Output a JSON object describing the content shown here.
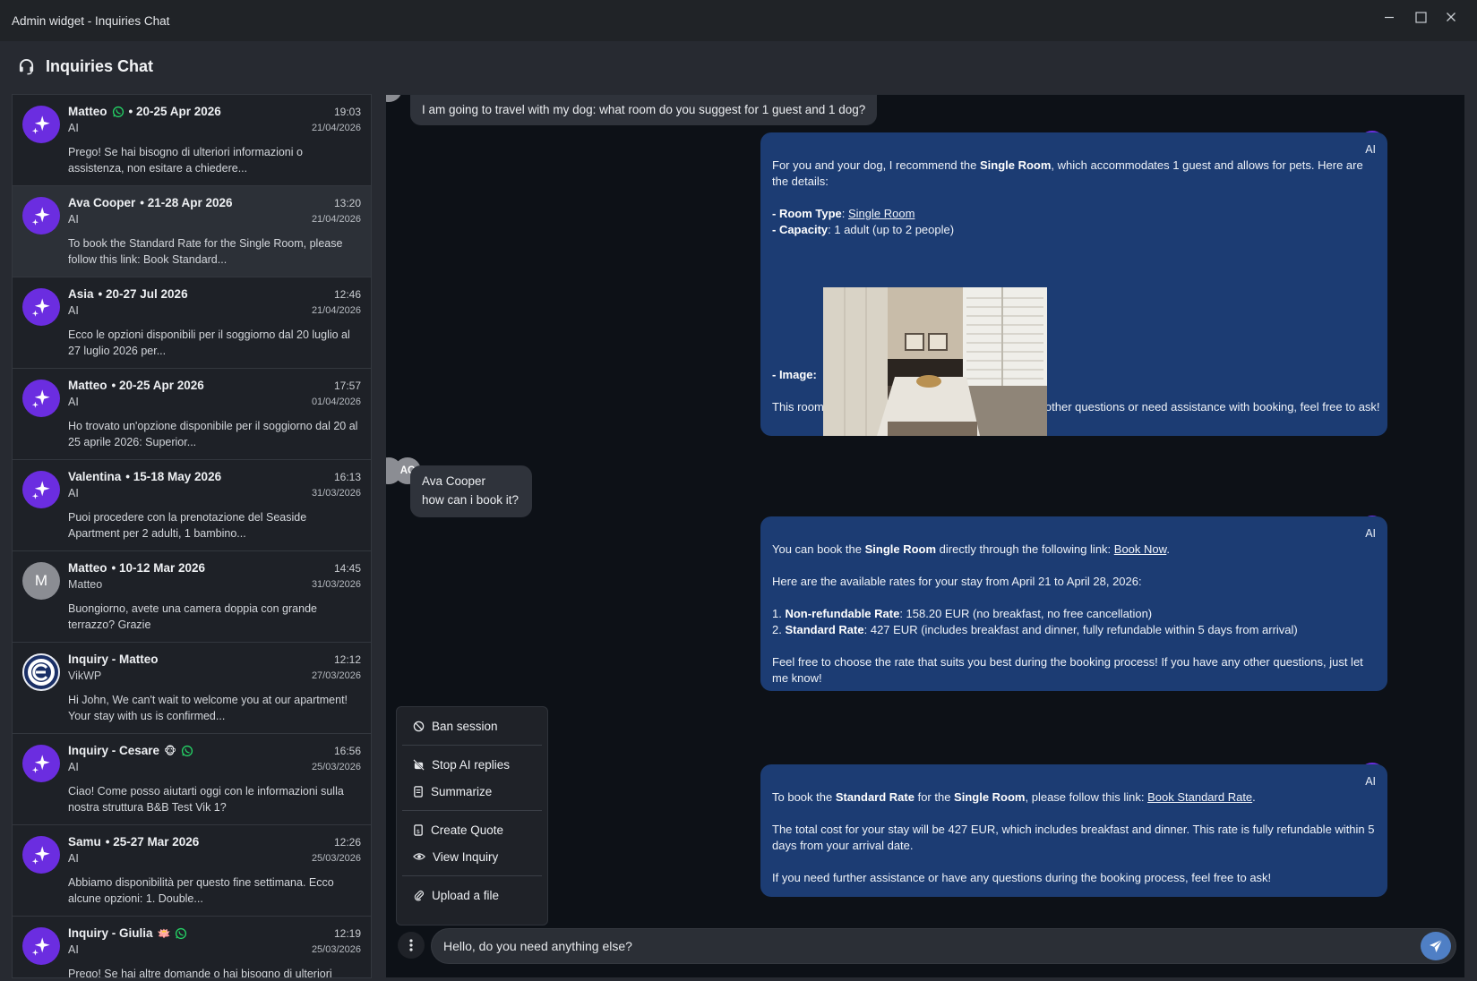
{
  "window": {
    "title": "Admin widget - Inquiries Chat"
  },
  "header": {
    "title": "Inquiries Chat"
  },
  "inquiries": [
    {
      "name": "Matteo",
      "whatsapp": true,
      "emoji": "",
      "dates": "• 20-25 Apr 2026",
      "time": "19:03",
      "sub": "AI",
      "date": "21/04/2026",
      "preview": "Prego! Se hai bisogno di ulteriori informazioni o assistenza, non esitare a chiedere...",
      "avatar": "ai"
    },
    {
      "name": "Ava Cooper",
      "whatsapp": false,
      "emoji": "",
      "dates": "• 21-28 Apr 2026",
      "time": "13:20",
      "sub": "AI",
      "date": "21/04/2026",
      "preview": "To book the Standard Rate for the Single Room, please follow this link: Book Standard...",
      "avatar": "ai"
    },
    {
      "name": "Asia",
      "whatsapp": false,
      "emoji": "",
      "dates": "• 20-27 Jul 2026",
      "time": "12:46",
      "sub": "AI",
      "date": "21/04/2026",
      "preview": "Ecco le opzioni disponibili per il soggiorno dal 20 luglio al 27 luglio 2026 per...",
      "avatar": "ai"
    },
    {
      "name": "Matteo",
      "whatsapp": false,
      "emoji": "",
      "dates": "• 20-25 Apr 2026",
      "time": "17:57",
      "sub": "AI",
      "date": "01/04/2026",
      "preview": "Ho trovato un'opzione disponibile per il soggiorno dal 20 al 25 aprile 2026: Superior...",
      "avatar": "ai"
    },
    {
      "name": "Valentina",
      "whatsapp": false,
      "emoji": "",
      "dates": "• 15-18 May 2026",
      "time": "16:13",
      "sub": "AI",
      "date": "31/03/2026",
      "preview": "Puoi procedere con la prenotazione del Seaside Apartment per 2 adulti, 1 bambino...",
      "avatar": "ai"
    },
    {
      "name": "Matteo",
      "whatsapp": false,
      "emoji": "",
      "dates": "• 10-12 Mar 2026",
      "time": "14:45",
      "sub": "Matteo",
      "date": "31/03/2026",
      "preview": "Buongiorno, avete una camera doppia con grande terrazzo? Grazie",
      "avatar": "m",
      "avatar_letter": "M"
    },
    {
      "name": "Inquiry - Matteo",
      "whatsapp": false,
      "emoji": "",
      "dates": "",
      "time": "12:12",
      "sub": "VikWP",
      "date": "27/03/2026",
      "preview": "Hi John, We can't wait to welcome you at our apartment! Your stay with us is confirmed...",
      "avatar": "vik"
    },
    {
      "name": "Inquiry - Cesare",
      "whatsapp": true,
      "emoji": "🐵",
      "dates": "",
      "time": "16:56",
      "sub": "AI",
      "date": "25/03/2026",
      "preview": "Ciao! Come posso aiutarti oggi con le informazioni sulla nostra struttura B&B Test Vik 1?",
      "avatar": "ai"
    },
    {
      "name": "Samu",
      "whatsapp": false,
      "emoji": "",
      "dates": "• 25-27 Mar 2026",
      "time": "12:26",
      "sub": "AI",
      "date": "25/03/2026",
      "preview": "Abbiamo disponibilità per questo fine settimana. Ecco alcune opzioni: 1. Double...",
      "avatar": "ai"
    },
    {
      "name": "Inquiry - Giulia",
      "whatsapp": true,
      "emoji": "🪷",
      "dates": "",
      "time": "12:19",
      "sub": "AI",
      "date": "25/03/2026",
      "preview": "Prego! Se hai altre domande o hai bisogno di ulteriori",
      "avatar": "ai"
    }
  ],
  "chat": {
    "msg1": "I am going to travel with my dog: what room do you suggest for 1 guest and 1 dog?",
    "ai_tag": "AI",
    "ai1": {
      "intro_a": "For you and your dog, I recommend the ",
      "intro_b": "Single Room",
      "intro_c": ", which accommodates 1 guest and allows for pets. Here are the details:",
      "rt_label": "- Room Type",
      "rt_value": "Single Room",
      "cap_label": "- Capacity",
      "cap_value": ": 1 adult (up to 2 people)",
      "img_label": "- Image",
      "outro": "This room is suitable for your needs. If you have any other questions or need assistance with booking, feel free to ask!"
    },
    "user2": {
      "initials": "AC",
      "name": "Ava Cooper",
      "text": "how can i book it?"
    },
    "ai2": {
      "l1a": "You can book the ",
      "l1b": "Single Room",
      "l1c": " directly through the following link: ",
      "l1d": "Book Now",
      "l2": "Here are the available rates for your stay from April 21 to April 28, 2026:",
      "r1a": "1. ",
      "r1b": "Non-refundable Rate",
      "r1c": ": 158.20 EUR (no breakfast, no free cancellation)",
      "r2a": "2. ",
      "r2b": "Standard Rate",
      "r2c": ": 427 EUR (includes breakfast and dinner, fully refundable within 5 days from arrival)",
      "l3": "Feel free to choose the rate that suits you best during the booking process! If you have any other questions, just let me know!"
    },
    "ai3": {
      "l1a": "To book the ",
      "l1b": "Standard Rate",
      "l1c": " for the ",
      "l1d": "Single Room",
      "l1e": ", please follow this link: ",
      "l1f": "Book Standard Rate",
      "l2": "The total cost for your stay will be 427 EUR, which includes breakfast and dinner. This rate is fully refundable within 5 days from your arrival date.",
      "l3": "If you need further assistance or have any questions during the booking process, feel free to ask!"
    }
  },
  "menu": {
    "ban": "Ban session",
    "stop_ai": "Stop AI replies",
    "summarize": "Summarize",
    "create_quote": "Create Quote",
    "view_inquiry": "View Inquiry",
    "upload": "Upload a file"
  },
  "composer": {
    "value": "Hello, do you need anything else?"
  },
  "colors": {
    "ai_accent": "#6b2de0",
    "ai_bubble": "#1c3c73",
    "send": "#4f7fc5",
    "whatsapp": "#25d366"
  }
}
